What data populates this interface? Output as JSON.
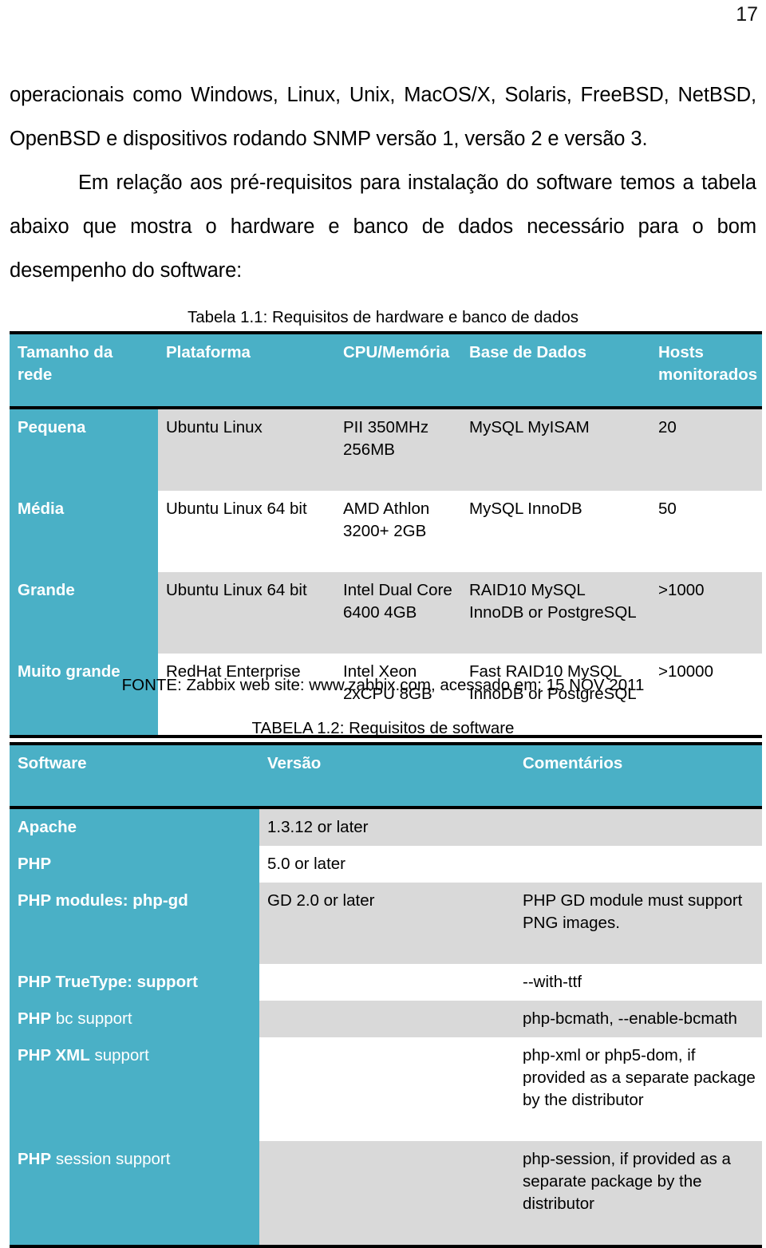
{
  "page": {
    "number": "17"
  },
  "prose": {
    "paragraph_1": "operacionais como Windows, Linux, Unix, MacOS/X, Solaris, FreeBSD, NetBSD, OpenBSD  e dispositivos rodando SNMP versão 1, versão 2 e versão 3.",
    "paragraph_2": "Em relação aos pré-requisitos para instalação do software temos a tabela abaixo que mostra o hardware e banco de dados necessário para o bom desempenho do software:"
  },
  "hardware_table": {
    "caption": "Tabela 1.1: Requisitos de hardware e banco de dados",
    "source_note": "FONTE: Zabbix web site: www.zabbix.com, acessado em: 15 NOV 2011",
    "headers": [
      "Tamanho da rede",
      "Plataforma",
      "CPU/Memória",
      "Base de Dados",
      "Hosts monitorados"
    ],
    "rows": [
      {
        "size": "Pequena",
        "platform": "Ubuntu Linux",
        "cpu": "PII 350MHz 256MB",
        "database": "MySQL MyISAM",
        "hosts": "20"
      },
      {
        "size": "Média",
        "platform": "Ubuntu Linux 64 bit",
        "cpu": "AMD Athlon 3200+ 2GB",
        "database": "MySQL InnoDB",
        "hosts": "50"
      },
      {
        "size": "Grande",
        "platform": "Ubuntu Linux 64 bit",
        "cpu": "Intel Dual Core 6400 4GB",
        "database": "RAID10 MySQL InnoDB or PostgreSQL",
        "hosts": ">1000"
      },
      {
        "size": "Muito grande",
        "platform": "RedHat Enterprise",
        "cpu": "Intel Xeon 2xCPU 8GB",
        "database": "Fast RAID10 MySQL InnoDB or PostgreSQL",
        "hosts": ">10000"
      }
    ]
  },
  "software_table": {
    "caption": "TABELA 1.2: Requisitos de software",
    "headers": [
      "Software",
      "Versão",
      "Comentários"
    ],
    "rows": [
      {
        "software_bold": "Apache",
        "software_rest": "",
        "version": "1.3.12 or later",
        "comments": ""
      },
      {
        "software_bold": "PHP",
        "software_rest": "",
        "version": "5.0 or later",
        "comments": ""
      },
      {
        "software_bold": "PHP modules: php-gd",
        "software_rest": "",
        "version": "GD 2.0 or later",
        "comments": "PHP GD module must support PNG images."
      },
      {
        "software_bold": "PHP TrueType: support",
        "software_rest": "",
        "version": "",
        "comments": "--with-ttf"
      },
      {
        "software_bold": "PHP",
        "software_rest": " bc support",
        "version": "",
        "comments": "php-bcmath, --enable-bcmath"
      },
      {
        "software_bold": "PHP XML",
        "software_rest": " support",
        "version": "",
        "comments": "php-xml or php5-dom, if provided as a separate package by the distributor"
      },
      {
        "software_bold": "PHP",
        "software_rest": " session support",
        "version": "",
        "comments": "php-session, if provided as a separate package by the distributor"
      }
    ]
  },
  "colors": {
    "header_teal": "#4AB0C6",
    "row_shaded": "#D9D9D9",
    "rule_black": "#000000"
  }
}
